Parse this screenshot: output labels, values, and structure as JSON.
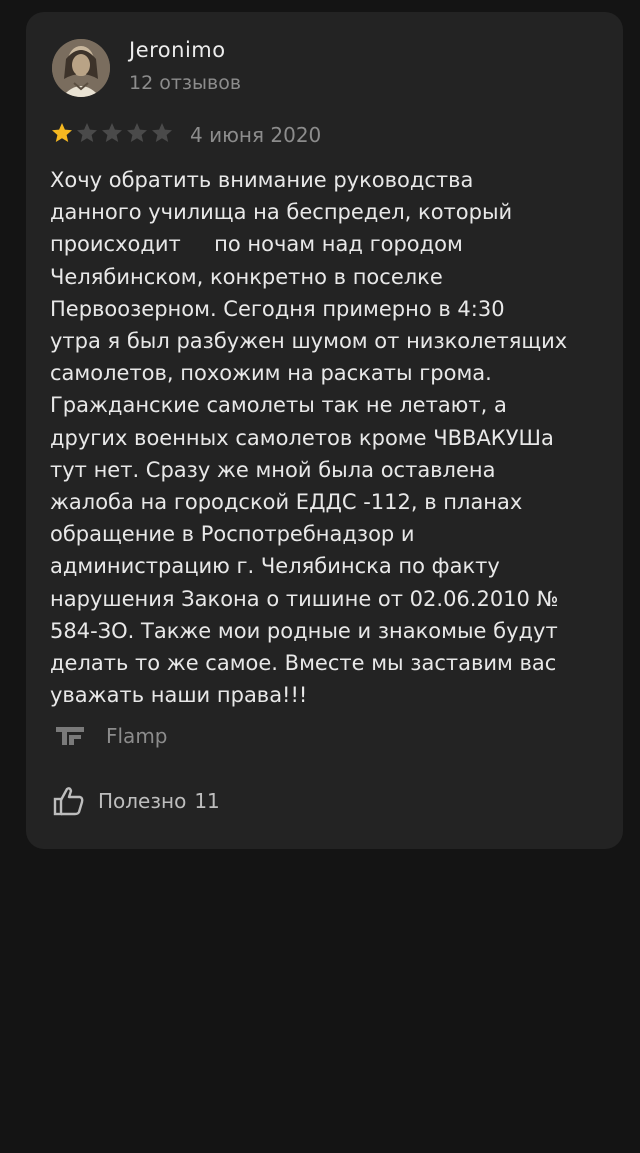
{
  "review": {
    "author": {
      "name": "Jeronimo",
      "reviews_count": "12 отзывов"
    },
    "rating": 1,
    "rating_max": 5,
    "date": "4 июня 2020",
    "text": "Хочу обратить внимание руководства\nданного училища на беспредел, который\nпроисходит     по ночам над городом\nЧелябинском, конкретно в поселке\nПервоозерном. Сегодня примерно в 4:30\nутра я был разбужен шумом от низколетящих\nсамолетов, похожим на раскаты грома.\nГражданские самолеты так не летают, а\nдругих военных самолетов кроме ЧВВАКУШа\nтут нет. Сразу же мной была оставлена\nжалоба на городской ЕДДС -112, в планах\nобращение в Роспотребнадзор и\nадминистрацию г. Челябинска по факту\nнарушения Закона о тишине от 02.06.2010 №\n584-ЗО. Также мои родные и знакомые будут\nделать то же самое. Вместе мы заставим вас\nуважать наши права!!!",
    "source": {
      "name": "Flamp",
      "icon": "flamp-logo-icon"
    },
    "useful": {
      "label": "Полезно",
      "count": "11",
      "icon": "thumbs-up-icon"
    }
  },
  "colors": {
    "background": "#141414",
    "card": "#232323",
    "star_filled": "#f5b820",
    "star_empty": "#4a4a4a",
    "muted_text": "#8c8c8c"
  }
}
